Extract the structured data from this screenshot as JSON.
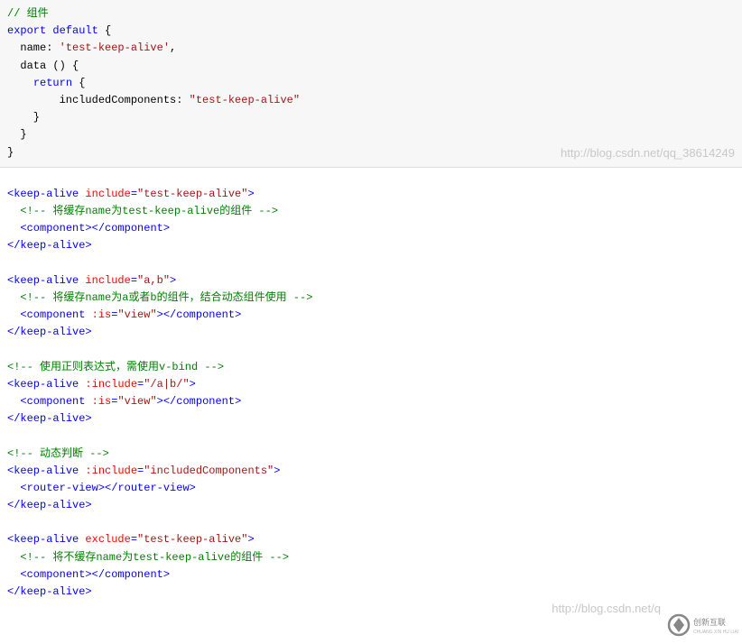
{
  "block1": {
    "l1": "// 组件",
    "l2a": "export default",
    "l2b": " {",
    "l3a": "  name: ",
    "l3b": "'test-keep-alive'",
    "l3c": ",",
    "l4": "  data () {",
    "l5a": "    ",
    "l5b": "return",
    "l5c": " {",
    "l6a": "        includedComponents: ",
    "l6b": "\"test-keep-alive\"",
    "l7": "    }",
    "l8": "  }",
    "l9": "}",
    "wm": "http://blog.csdn.net/qq_38614249"
  },
  "block2": {
    "l1a": "<",
    "l1b": "keep-alive",
    "l1c": " include",
    "l1d": "=",
    "l1e": "\"test-keep-alive\"",
    "l1f": ">",
    "l2": "  <!-- 将缓存name为test-keep-alive的组件 -->",
    "l3a": "  <",
    "l3b": "component",
    "l3c": "></",
    "l3d": "component",
    "l3e": ">",
    "l4a": "</",
    "l4b": "keep-alive",
    "l4c": ">",
    "l6a": "<",
    "l6b": "keep-alive",
    "l6c": " include",
    "l6d": "=",
    "l6e": "\"a,b\"",
    "l6f": ">",
    "l7": "  <!-- 将缓存name为a或者b的组件，结合动态组件使用 -->",
    "l8a": "  <",
    "l8b": "component",
    "l8c": " :is",
    "l8d": "=",
    "l8e": "\"view\"",
    "l8f": "></",
    "l8g": "component",
    "l8h": ">",
    "l9a": "</",
    "l9b": "keep-alive",
    "l9c": ">",
    "l11": "<!-- 使用正则表达式，需使用v-bind -->",
    "l12a": "<",
    "l12b": "keep-alive",
    "l12c": " :include",
    "l12d": "=",
    "l12e": "\"/a|b/\"",
    "l12f": ">",
    "l13a": "  <",
    "l13b": "component",
    "l13c": " :is",
    "l13d": "=",
    "l13e": "\"view\"",
    "l13f": "></",
    "l13g": "component",
    "l13h": ">",
    "l14a": "</",
    "l14b": "keep-alive",
    "l14c": ">",
    "l16": "<!-- 动态判断 -->",
    "l17a": "<",
    "l17b": "keep-alive",
    "l17c": " :include",
    "l17d": "=",
    "l17e": "\"includedComponents\"",
    "l17f": ">",
    "l18a": "  <",
    "l18b": "router-view",
    "l18c": "></",
    "l18d": "router-view",
    "l18e": ">",
    "l19a": "</",
    "l19b": "keep-alive",
    "l19c": ">",
    "l21a": "<",
    "l21b": "keep-alive",
    "l21c": " exclude",
    "l21d": "=",
    "l21e": "\"test-keep-alive\"",
    "l21f": ">",
    "l22": "  <!-- 将不缓存name为test-keep-alive的组件 -->",
    "l23a": "  <",
    "l23b": "component",
    "l23c": "></",
    "l23d": "component",
    "l23e": ">",
    "l24a": "</",
    "l24b": "keep-alive",
    "l24c": ">",
    "wm": "http://blog.csdn.net/q",
    "logo_text": "创新互联"
  }
}
